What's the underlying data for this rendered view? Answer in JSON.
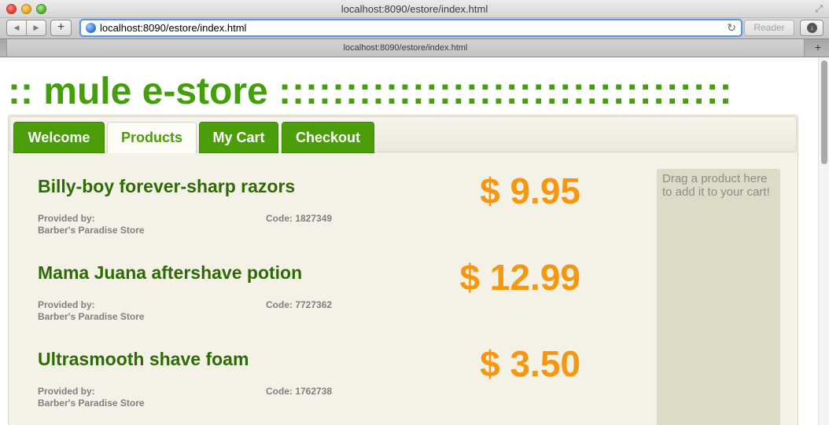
{
  "browser": {
    "window_title": "localhost:8090/estore/index.html",
    "url": "localhost:8090/estore/index.html",
    "tab_title": "localhost:8090/estore/index.html",
    "reader_label": "Reader",
    "back_icon": "◀",
    "forward_icon": "▶",
    "add_icon": "+",
    "reload_icon": "↻",
    "download_icon": "↓",
    "newtab_icon": "+",
    "fullscreen_icon": "⤢"
  },
  "store": {
    "title_prefix": ":: mule e-store ",
    "title_dots": "::::::::::::::::::::::::::::::::::"
  },
  "tabs": [
    {
      "label": "Welcome",
      "active": false
    },
    {
      "label": "Products",
      "active": true
    },
    {
      "label": "My Cart",
      "active": false
    },
    {
      "label": "Checkout",
      "active": false
    }
  ],
  "products": [
    {
      "name": "Billy-boy forever-sharp razors",
      "price": "$ 9.95",
      "provided_label": "Provided by:",
      "provider": "Barber's Paradise Store",
      "code": "Code: 1827349"
    },
    {
      "name": "Mama Juana aftershave potion",
      "price": "$ 12.99",
      "provided_label": "Provided by:",
      "provider": "Barber's Paradise Store",
      "code": "Code: 7727362"
    },
    {
      "name": "Ultrasmooth shave foam",
      "price": "$ 3.50",
      "provided_label": "Provided by:",
      "provider": "Barber's Paradise Store",
      "code": "Code: 1762738"
    }
  ],
  "cart": {
    "drop_hint": "Drag a product here to add it to your cart!"
  },
  "colors": {
    "brand_green": "#44a00a",
    "tab_green": "#4b9d09",
    "product_name": "#2e6b06",
    "price_orange": "#f7960f",
    "panel_bg": "#f4f1e6",
    "cart_bg": "#dcdbc8"
  }
}
